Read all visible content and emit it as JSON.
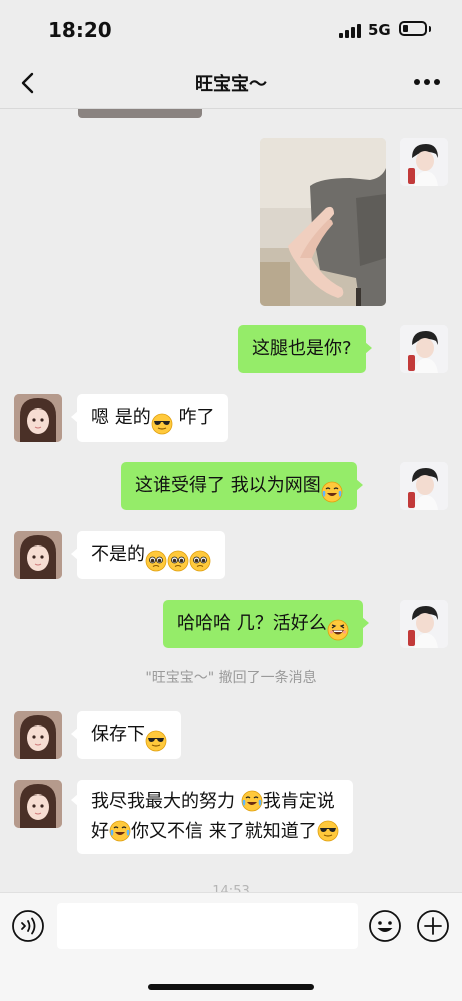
{
  "status_bar": {
    "time": "18:20",
    "network": "5G",
    "battery_level": 0.25
  },
  "header": {
    "title": "旺宝宝～",
    "back_icon": "chevron-left-icon",
    "more_icon": "more-dots-icon"
  },
  "messages": [
    {
      "side": "me",
      "type": "image",
      "content": "leg-photo"
    },
    {
      "side": "me",
      "type": "text",
      "parts": [
        "这腿也是你?"
      ]
    },
    {
      "side": "her",
      "type": "text",
      "parts": [
        "嗯 是的",
        "[sunglasses]",
        " 咋了"
      ]
    },
    {
      "side": "me",
      "type": "text",
      "parts": [
        "这谁受得了 我以为网图",
        "[tears-of-joy]"
      ]
    },
    {
      "side": "her",
      "type": "text",
      "parts": [
        "不是的",
        "[pleading]",
        "[pleading]",
        "[pleading]"
      ]
    },
    {
      "side": "me",
      "type": "text",
      "parts": [
        "哈哈哈 几？活好么",
        "[grinning-squint]"
      ]
    },
    {
      "type": "system",
      "text": "\"旺宝宝～\" 撤回了一条消息"
    },
    {
      "side": "her",
      "type": "text",
      "parts": [
        "保存下",
        "[sunglasses]"
      ]
    },
    {
      "side": "her",
      "type": "text",
      "lines": [
        [
          "我尽我最大的努力 ",
          "[tears-of-joy]",
          "我肯定说"
        ],
        [
          "好",
          "[tears-of-joy]",
          "你又不信 来了就知道了",
          "[sunglasses]"
        ]
      ]
    }
  ],
  "timestamp": "14:53",
  "input_bar": {
    "voice_icon": "voice-icon",
    "input_value": "",
    "emoji_icon": "smiley-icon",
    "plus_icon": "plus-circle-icon"
  }
}
